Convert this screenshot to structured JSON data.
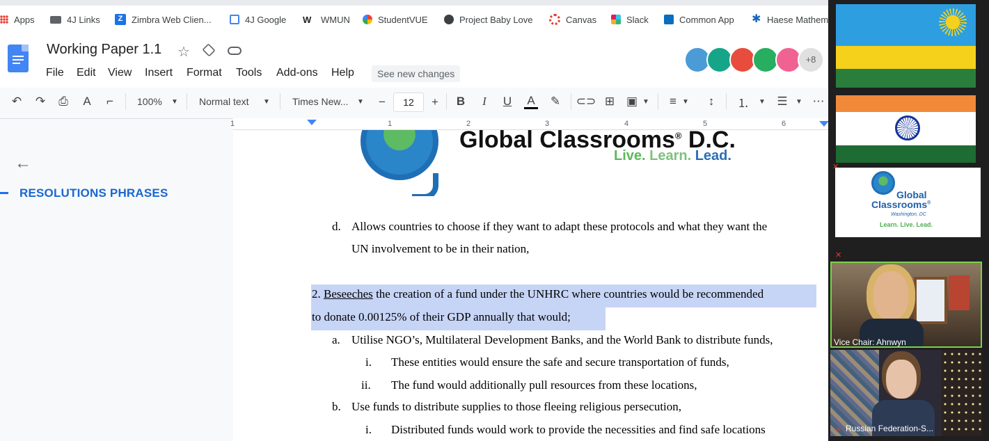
{
  "bookmarks": [
    {
      "label": "Apps",
      "icon": "apps-grid-icon",
      "color": "#ea4335"
    },
    {
      "label": "4J Links",
      "icon": "folder-icon",
      "color": "#5f6368"
    },
    {
      "label": "Zimbra Web Clien...",
      "icon": "zimbra-icon",
      "color": "#1a73e8"
    },
    {
      "label": "4J Google",
      "icon": "google-sites-icon",
      "color": "#4285f4"
    },
    {
      "label": "WMUN",
      "icon": "wmun-icon",
      "color": "#202124"
    },
    {
      "label": "StudentVUE",
      "icon": "studentvue-icon",
      "color": "#34a853"
    },
    {
      "label": "Project Baby Love",
      "icon": "globe-icon",
      "color": "#3c4043"
    },
    {
      "label": "Canvas",
      "icon": "canvas-icon",
      "color": "#e03c31"
    },
    {
      "label": "Slack",
      "icon": "slack-icon",
      "color": "#611f69"
    },
    {
      "label": "Common App",
      "icon": "common-app-icon",
      "color": "#0a6dbd"
    },
    {
      "label": "Haese Mathem",
      "icon": "haese-icon",
      "color": "#1565c0"
    }
  ],
  "doc": {
    "title": "Working Paper 1.1",
    "menu": [
      "File",
      "Edit",
      "View",
      "Insert",
      "Format",
      "Tools",
      "Add-ons",
      "Help"
    ],
    "see_changes": "See new changes",
    "collaborators_more": "+8"
  },
  "toolbar": {
    "zoom": "100%",
    "style": "Normal text",
    "font": "Times New...",
    "font_size": "12",
    "bold": "B",
    "italic": "I",
    "underline": "U",
    "text_color": "A",
    "more": "⋯"
  },
  "ruler": [
    "1",
    "1",
    "2",
    "3",
    "4",
    "5",
    "6"
  ],
  "sidebar": {
    "heading": "RESOLUTIONS PHRASES"
  },
  "logo": {
    "name": "Global Classrooms",
    "reg": "®",
    "suffix": " D.C.",
    "tagline_live": "Live.",
    "tagline_learn": " Learn.",
    "tagline_lead": " Lead."
  },
  "document_lines": {
    "d_marker": "d.",
    "d_line1": "Allows countries to choose if they want to adapt these protocols and what they want the",
    "d_line2": "UN involvement to be in their nation,",
    "c2_num": "2. ",
    "c2_verb": "Beseeches",
    "c2_line1_rest": " the creation of a fund under the UNHRC where countries would be recommended",
    "c2_line2": "to donate 0.00125% of their GDP annually that would;",
    "a_marker": "a.",
    "a_text": "Utilise NGO’s, Multilateral Development Banks, and the World Bank to distribute funds,",
    "ai_marker": "i.",
    "ai_text": "These entities would ensure the safe and secure transportation of funds,",
    "aii_marker": "ii.",
    "aii_text": "The fund would additionally pull resources from these locations,",
    "b_marker": "b.",
    "b_text": "Use funds to distribute supplies to those fleeing religious persecution,",
    "bi_marker": "i.",
    "bi_text": "Distributed funds would work to provide the necessities and find safe locations"
  },
  "video": {
    "gc_logo_line1": "Global",
    "gc_logo_line2": "Classrooms",
    "gc_logo_reg": "®",
    "gc_logo_city": "Washington, DC",
    "gc_logo_tag": "Learn. Live. Lead.",
    "participant1": "Vice Chair: Ahnwyn",
    "participant2": "Russian Federation-S..."
  }
}
